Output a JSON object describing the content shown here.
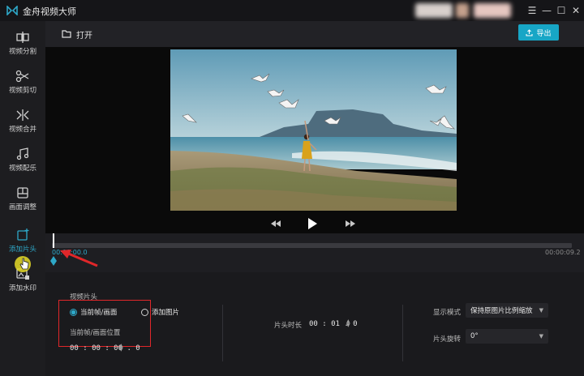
{
  "app": {
    "title": "金舟视频大师"
  },
  "window_controls": {
    "menu": "☰",
    "minimize": "—",
    "maximize": "☐",
    "close": "✕"
  },
  "sidebar": {
    "items": [
      {
        "label": "视频分割",
        "icon": "split-icon"
      },
      {
        "label": "视频剪切",
        "icon": "scissors-icon"
      },
      {
        "label": "视频合并",
        "icon": "merge-icon"
      },
      {
        "label": "视频配乐",
        "icon": "music-icon"
      },
      {
        "label": "画面调整",
        "icon": "crop-icon"
      },
      {
        "label": "添加片头",
        "icon": "add-intro-icon",
        "active": true
      },
      {
        "label": "添加水印",
        "icon": "watermark-icon"
      }
    ]
  },
  "toolbar": {
    "open_label": "打开",
    "export_label": "导出"
  },
  "colors": {
    "accent": "#17a6c6",
    "annotation": "#e0272a"
  },
  "timeline": {
    "current_time": "00:00:00.0",
    "total_time": "00:00:09.2",
    "progress": 0.0
  },
  "settings": {
    "section_title": "视频片头",
    "radio_current_frame": "当前帧/画面",
    "radio_add_image": "添加图片",
    "frame_position_label": "当前帧/画面位置",
    "frame_position_value": "00 : 00 : 00 . 0",
    "duration_label": "片头时长",
    "duration_value": "00 : 01 . 0",
    "display_mode_label": "显示模式",
    "display_mode_value": "保持原图片比例缩放",
    "rotation_label": "片头旋转",
    "rotation_value": "0°"
  }
}
